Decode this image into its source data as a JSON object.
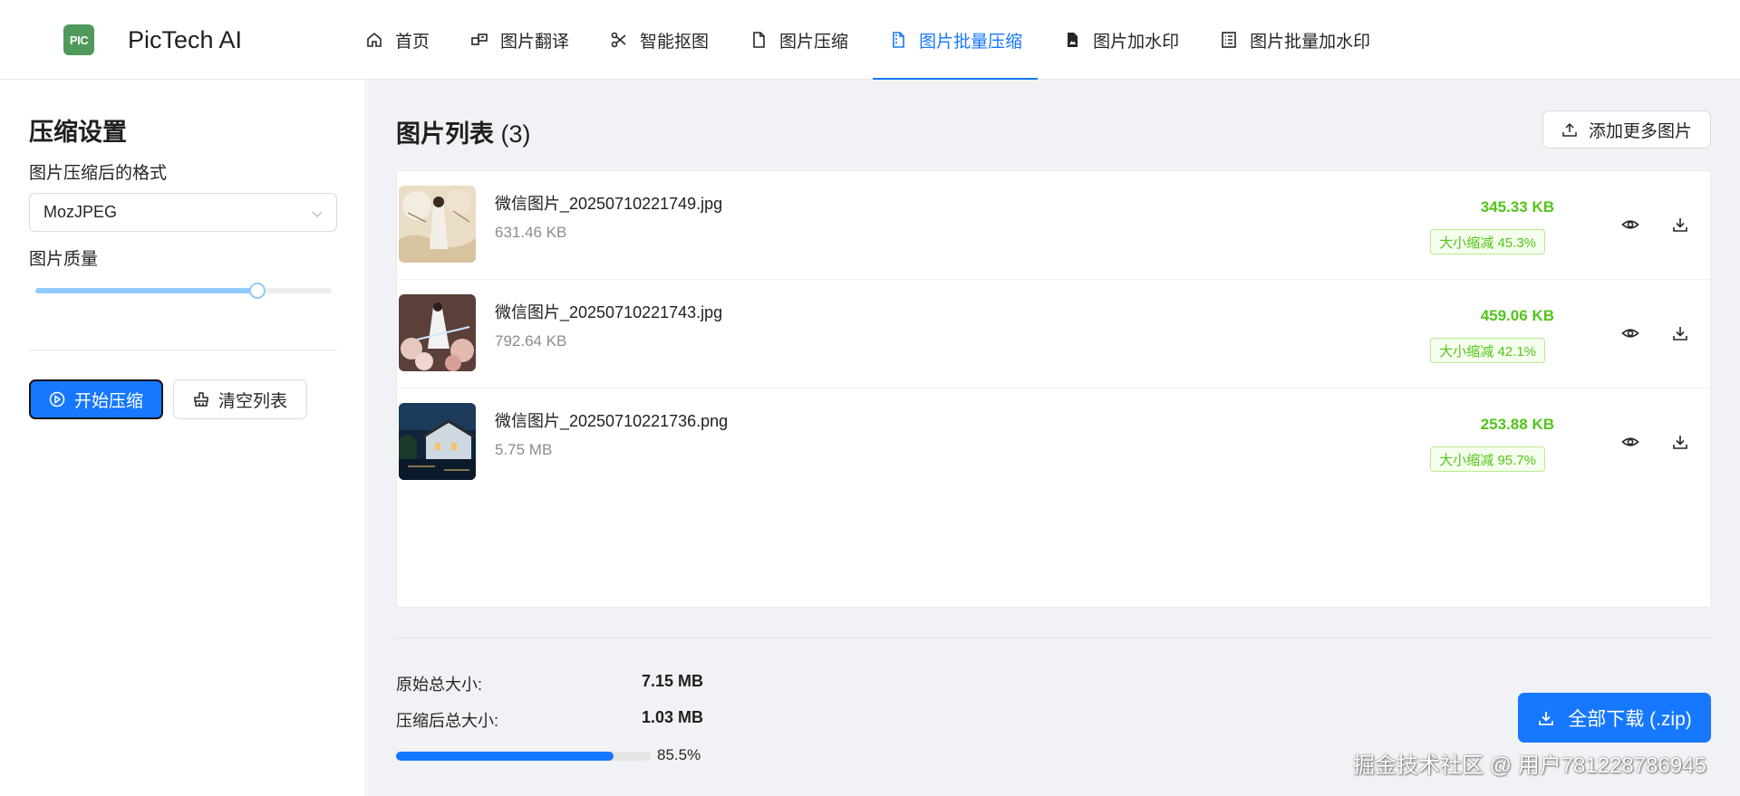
{
  "app": {
    "logo_text": "PIC",
    "brand": "PicTech AI"
  },
  "nav": [
    {
      "label": "首页",
      "icon": "home-icon"
    },
    {
      "label": "图片翻译",
      "icon": "translate-icon"
    },
    {
      "label": "智能抠图",
      "icon": "scissors-icon"
    },
    {
      "label": "图片压缩",
      "icon": "file-icon"
    },
    {
      "label": "图片批量压缩",
      "icon": "file-zip-icon",
      "active": true
    },
    {
      "label": "图片加水印",
      "icon": "file-image-icon"
    },
    {
      "label": "图片批量加水印",
      "icon": "list-icon"
    }
  ],
  "settings": {
    "title": "压缩设置",
    "format_label": "图片压缩后的格式",
    "format_value": "MozJPEG",
    "quality_label": "图片质量",
    "quality_fraction": 0.75,
    "start_button": "开始压缩",
    "clear_button": "清空列表"
  },
  "list": {
    "title": "图片列表",
    "count": "(3)",
    "add_button": "添加更多图片",
    "items": [
      {
        "name": "微信图片_20250710221749.jpg",
        "original_size": "631.46 KB",
        "compressed_size": "345.33 KB",
        "reduction": "大小缩减 45.3%",
        "thumb": "portrait-blossom"
      },
      {
        "name": "微信图片_20250710221743.jpg",
        "original_size": "792.64 KB",
        "compressed_size": "459.06 KB",
        "reduction": "大小缩减 42.1%",
        "thumb": "warrior-flowers"
      },
      {
        "name": "微信图片_20250710221736.png",
        "original_size": "5.75 MB",
        "compressed_size": "253.88 KB",
        "reduction": "大小缩减 95.7%",
        "thumb": "night-village"
      }
    ]
  },
  "summary": {
    "original_label": "原始总大小:",
    "original_value": "7.15 MB",
    "compressed_label": "压缩后总大小:",
    "compressed_value": "1.03 MB",
    "progress_fraction": 0.855,
    "progress_text": "85.5%",
    "download_all": "全部下载 (.zip)"
  },
  "watermark": "掘金技术社区 @ 用户781228786945",
  "colors": {
    "primary": "#1677ff",
    "success": "#52c41a",
    "logo": "#4f9a5a",
    "background": "#f0f2f5"
  }
}
